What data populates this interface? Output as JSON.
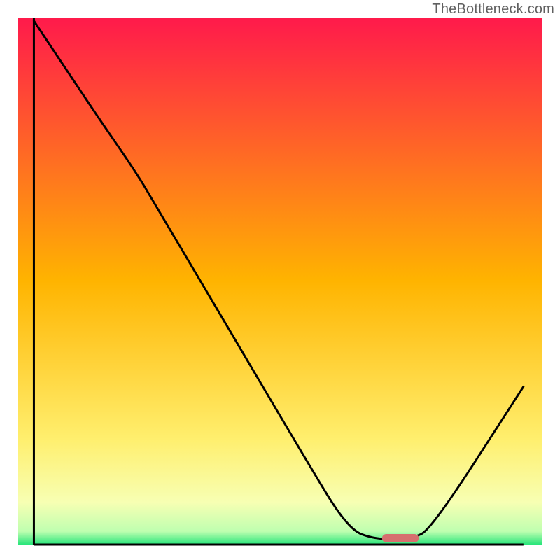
{
  "watermark": "TheBottleneck.com",
  "chart_data": {
    "type": "line",
    "title": "",
    "xlabel": "",
    "ylabel": "",
    "xlim": [
      0,
      100
    ],
    "ylim": [
      0,
      100
    ],
    "background_gradient": {
      "stops": [
        {
          "offset": 0.0,
          "color": "#ff1a4b"
        },
        {
          "offset": 0.5,
          "color": "#ffb400"
        },
        {
          "offset": 0.8,
          "color": "#ffef6e"
        },
        {
          "offset": 0.92,
          "color": "#f7ffb3"
        },
        {
          "offset": 0.975,
          "color": "#bfffb0"
        },
        {
          "offset": 1.0,
          "color": "#28e57a"
        }
      ]
    },
    "curve": [
      {
        "x": 3.0,
        "y": 99.5
      },
      {
        "x": 14.0,
        "y": 83.0
      },
      {
        "x": 22.0,
        "y": 71.5
      },
      {
        "x": 26.0,
        "y": 65.0
      },
      {
        "x": 55.0,
        "y": 16.0
      },
      {
        "x": 63.0,
        "y": 3.0
      },
      {
        "x": 68.0,
        "y": 1.0
      },
      {
        "x": 75.0,
        "y": 1.0
      },
      {
        "x": 79.0,
        "y": 3.0
      },
      {
        "x": 96.5,
        "y": 30.0
      }
    ],
    "marker": {
      "x": 73.0,
      "y": 1.2,
      "width": 7.0,
      "height": 1.6,
      "color": "#d6706f"
    },
    "axes": {
      "left": {
        "x": 3.0,
        "y1": 0.0,
        "y2": 100.0
      },
      "bottom": {
        "y": 0.0,
        "x1": 3.0,
        "x2": 96.5
      }
    }
  }
}
